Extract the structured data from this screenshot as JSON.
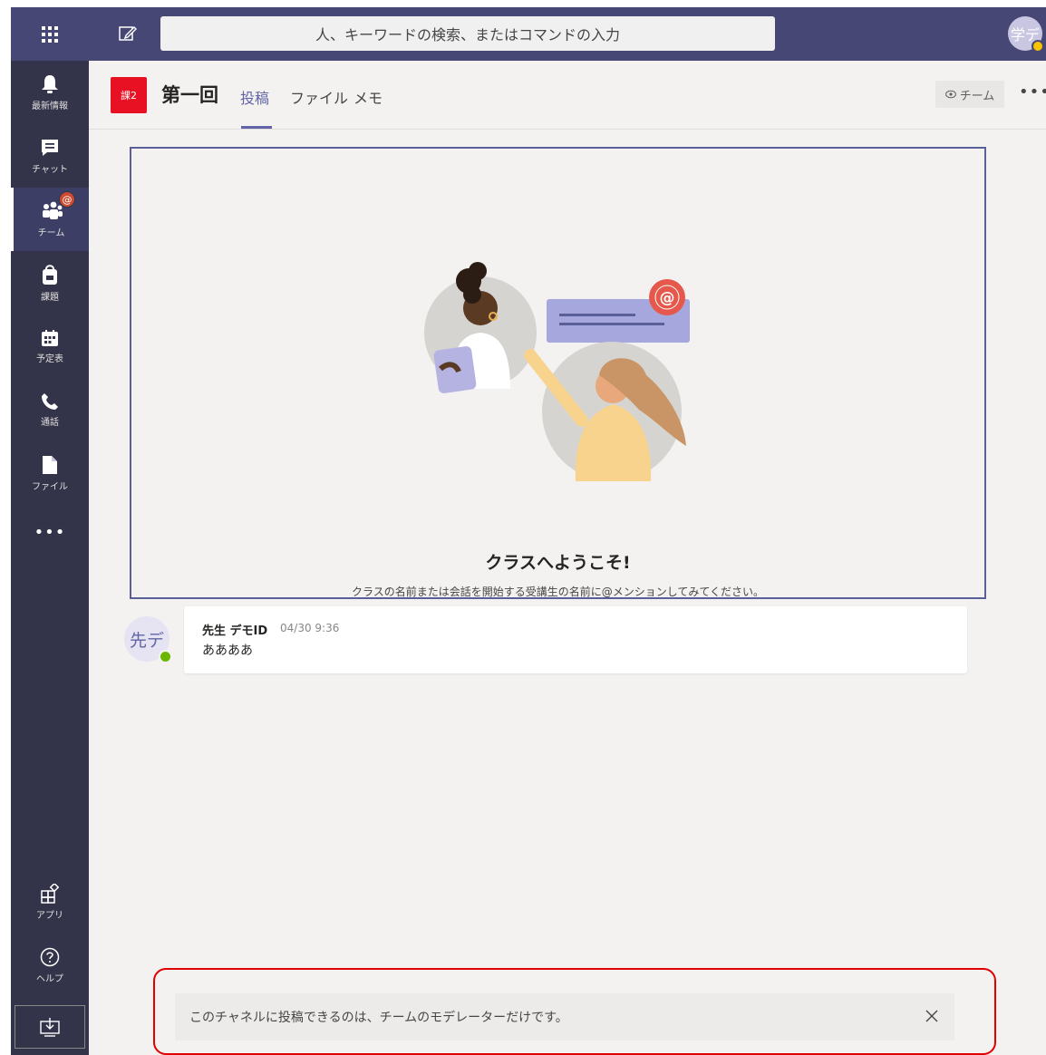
{
  "topbar": {
    "search_placeholder": "人、キーワードの検索、またはコマンドの入力",
    "avatar_initials": "学デ"
  },
  "rail": {
    "items": [
      {
        "label": "最新情報",
        "icon": "bell-icon"
      },
      {
        "label": "チャット",
        "icon": "chat-icon"
      },
      {
        "label": "チーム",
        "icon": "teams-icon",
        "active": true,
        "badge": "@"
      },
      {
        "label": "課題",
        "icon": "assignments-icon"
      },
      {
        "label": "予定表",
        "icon": "calendar-icon"
      },
      {
        "label": "通話",
        "icon": "phone-icon"
      },
      {
        "label": "ファイル",
        "icon": "file-icon"
      }
    ],
    "more": "•••",
    "bottom": [
      {
        "label": "アプリ",
        "icon": "apps-icon"
      },
      {
        "label": "ヘルプ",
        "icon": "help-icon"
      }
    ]
  },
  "channel": {
    "team_tile": "課2",
    "title": "第一回",
    "tabs": [
      {
        "label": "投稿",
        "active": true
      },
      {
        "label": "ファイル"
      },
      {
        "label": "メモ"
      }
    ],
    "team_button": "チーム",
    "more": "•••"
  },
  "welcome": {
    "title": "クラスへようこそ!",
    "subtitle": "クラスの名前または会話を開始する受講生の名前に@メンションしてみてください。"
  },
  "message": {
    "avatar": "先デ",
    "author": "先生 デモID",
    "time": "04/30 9:36",
    "body": "ああああ"
  },
  "notice": {
    "text": "このチャネルに投稿できるのは、チームのモデレーターだけです。"
  },
  "colors": {
    "accent": "#6264a7",
    "topbar": "#464775",
    "rail": "#33344a",
    "alert_outline": "#e00000"
  }
}
